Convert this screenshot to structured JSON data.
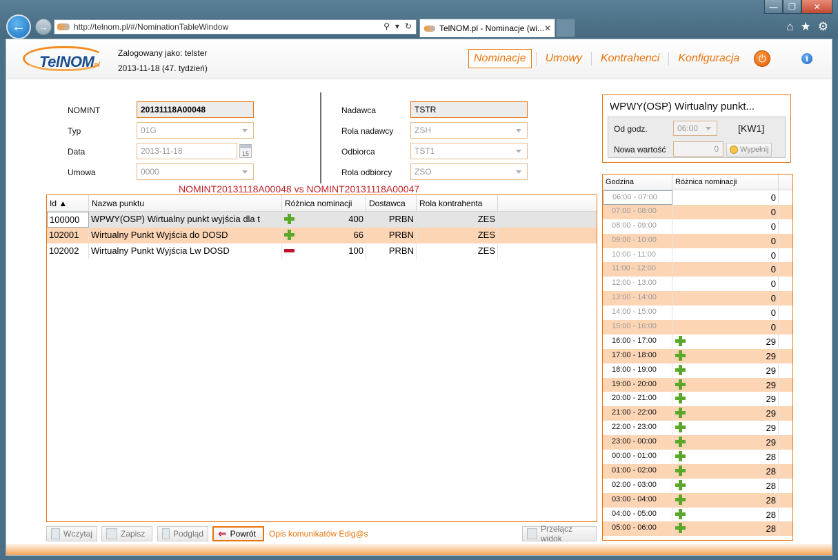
{
  "browser": {
    "url": "http://telnom.pl/#/NominationTableWindow",
    "tab_title": "TelNOM.pl - Nominacje (wi...",
    "back_glyph": "←",
    "forward_glyph": "→",
    "close_tab": "✕",
    "window_minimize": "—",
    "window_restore": "❐",
    "window_close": "✕"
  },
  "header": {
    "logo_text": "TelNOM",
    "logo_suffix": "pl",
    "logged_in": "Zalogowany jako: telster",
    "date_week": "2013-11-18 (47. tydzień)",
    "nav": [
      {
        "label": "Nominacje",
        "active": true
      },
      {
        "label": "Umowy",
        "active": false
      },
      {
        "label": "Kontrahenci",
        "active": false
      },
      {
        "label": "Konfiguracja",
        "active": false
      }
    ],
    "info_glyph": "i"
  },
  "form": {
    "left": [
      {
        "label": "NOMINT",
        "value": "20131118A00048"
      },
      {
        "label": "Typ",
        "value": "01G"
      },
      {
        "label": "Data",
        "value": "2013-11-18"
      },
      {
        "label": "Umowa",
        "value": "0000"
      }
    ],
    "right": [
      {
        "label": "Nadawca",
        "value": "TSTR"
      },
      {
        "label": "Rola nadawcy",
        "value": "ZSH"
      },
      {
        "label": "Odbiorca",
        "value": "TST1"
      },
      {
        "label": "Rola odbiorcy",
        "value": "ZSO"
      }
    ],
    "calendar_day": "15"
  },
  "compare_title": "NOMINT20131118A00048 vs NOMINT20131118A00047",
  "grid": {
    "columns": [
      "Id ▲",
      "Nazwa punktu",
      "Różnica nominacji",
      "Dostawca",
      "Rola kontrahenta"
    ],
    "rows": [
      {
        "id": "100000",
        "name": "WPWY(OSP) Wirtualny punkt wyjścia dla t",
        "sign": "plus",
        "diff": "400",
        "supplier": "PRBN",
        "role": "ZES"
      },
      {
        "id": "102001",
        "name": "Wirtualny Punkt Wyjścia do DOSD",
        "sign": "plus",
        "diff": "66",
        "supplier": "PRBN",
        "role": "ZES"
      },
      {
        "id": "102002",
        "name": "Wirtualny Punkt Wyjścia Lw DOSD",
        "sign": "minus",
        "diff": "100",
        "supplier": "PRBN",
        "role": "ZES"
      }
    ]
  },
  "toolbar": {
    "load": "Wczytaj",
    "save": "Zapisz",
    "preview": "Podgląd",
    "back": "Powrót",
    "link": "Opis komunikatów Edig@s",
    "switch_view": "Przełącz widok"
  },
  "point_panel": {
    "title": "WPWY(OSP) Wirtualny punkt...",
    "from_label": "Od godz.",
    "from_value": "06:00",
    "kw": "[KW1]",
    "new_value_label": "Nowa wartość",
    "new_value": "0",
    "fill_button": "Wypełnij"
  },
  "hours": {
    "columns": [
      "Godzina",
      "Różnica nominacji"
    ],
    "rows": [
      {
        "hour": "06:00 - 07:00",
        "value": "0",
        "sign": ""
      },
      {
        "hour": "07:00 - 08:00",
        "value": "0",
        "sign": ""
      },
      {
        "hour": "08:00 - 09:00",
        "value": "0",
        "sign": ""
      },
      {
        "hour": "09:00 - 10:00",
        "value": "0",
        "sign": ""
      },
      {
        "hour": "10:00 - 11:00",
        "value": "0",
        "sign": ""
      },
      {
        "hour": "11:00 - 12:00",
        "value": "0",
        "sign": ""
      },
      {
        "hour": "12:00 - 13:00",
        "value": "0",
        "sign": ""
      },
      {
        "hour": "13:00 - 14:00",
        "value": "0",
        "sign": ""
      },
      {
        "hour": "14:00 - 15:00",
        "value": "0",
        "sign": ""
      },
      {
        "hour": "15:00 - 16:00",
        "value": "0",
        "sign": ""
      },
      {
        "hour": "16:00 - 17:00",
        "value": "29",
        "sign": "plus"
      },
      {
        "hour": "17:00 - 18:00",
        "value": "29",
        "sign": "plus"
      },
      {
        "hour": "18:00 - 19:00",
        "value": "29",
        "sign": "plus"
      },
      {
        "hour": "19:00 - 20:00",
        "value": "29",
        "sign": "plus"
      },
      {
        "hour": "20:00 - 21:00",
        "value": "29",
        "sign": "plus"
      },
      {
        "hour": "21:00 - 22:00",
        "value": "29",
        "sign": "plus"
      },
      {
        "hour": "22:00 - 23:00",
        "value": "29",
        "sign": "plus"
      },
      {
        "hour": "23:00 - 00:00",
        "value": "29",
        "sign": "plus"
      },
      {
        "hour": "00:00 - 01:00",
        "value": "28",
        "sign": "plus"
      },
      {
        "hour": "01:00 - 02:00",
        "value": "28",
        "sign": "plus"
      },
      {
        "hour": "02:00 - 03:00",
        "value": "28",
        "sign": "plus"
      },
      {
        "hour": "03:00 - 04:00",
        "value": "28",
        "sign": "plus"
      },
      {
        "hour": "04:00 - 05:00",
        "value": "28",
        "sign": "plus"
      },
      {
        "hour": "05:00 - 06:00",
        "value": "28",
        "sign": "plus"
      }
    ]
  },
  "colors": {
    "accent": "#e8740c",
    "row_alt": "#fcd5b5",
    "compare_title": "#c0232a",
    "plus": "#5aa82a",
    "minus": "#c0142b"
  }
}
